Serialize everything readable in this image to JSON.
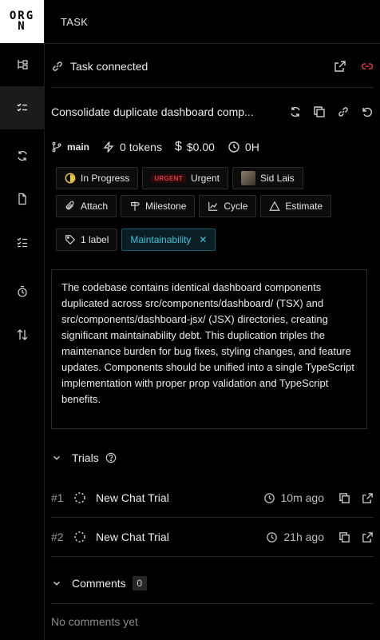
{
  "brand": {
    "logo_line1": "ORG",
    "logo_line2": "N"
  },
  "header": {
    "title": "TASK"
  },
  "sidebar": {
    "items": [
      {
        "icon": "tree-icon"
      },
      {
        "icon": "task-list-icon",
        "active": true
      },
      {
        "icon": "sync-icon"
      },
      {
        "icon": "document-icon"
      },
      {
        "icon": "checklist-icon"
      },
      {
        "icon": "history-icon"
      },
      {
        "icon": "sort-icon"
      }
    ]
  },
  "connection": {
    "label": "Task connected"
  },
  "task": {
    "title": "Consolidate duplicate dashboard comp...",
    "branch": "main",
    "tokens": "0 tokens",
    "cost": "$0.00",
    "time": "0H",
    "status": "In Progress",
    "priority_tag": "URGENT",
    "priority": "Urgent",
    "assignee": "Sid Lais",
    "actions": {
      "attach": "Attach",
      "milestone": "Milestone",
      "cycle": "Cycle",
      "estimate": "Estimate"
    },
    "label_count": "1 label",
    "tag": "Maintainability",
    "description": "The codebase contains identical dashboard components duplicated across src/components/dashboard/ (TSX) and src/components/dashboard-jsx/ (JSX) directories, creating significant maintainability debt. This duplication triples the maintenance burden for bug fixes, styling changes, and feature updates. Components should be unified into a single TypeScript implementation with proper prop validation and TypeScript benefits."
  },
  "trials": {
    "title": "Trials",
    "items": [
      {
        "num": "#1",
        "name": "New Chat Trial",
        "time": "10m ago"
      },
      {
        "num": "#2",
        "name": "New Chat Trial",
        "time": "21h ago"
      }
    ]
  },
  "comments": {
    "title": "Comments",
    "count": "0",
    "empty": "No comments yet"
  },
  "colors": {
    "accent": "#3fc3dd",
    "urgent": "#e0383e",
    "link_unlink": "#e0383e"
  }
}
